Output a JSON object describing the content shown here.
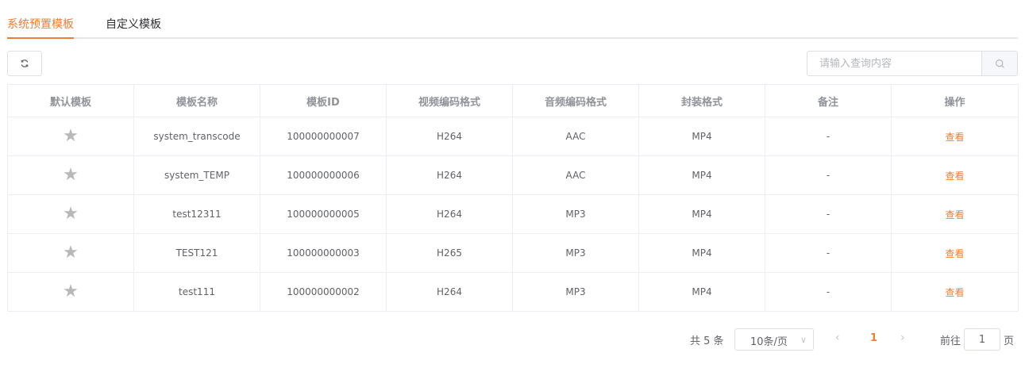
{
  "tabs": [
    {
      "label": "系统预置模板",
      "active": true
    },
    {
      "label": "自定义模板",
      "active": false
    }
  ],
  "toolbar": {
    "refresh_icon": "refresh-icon",
    "search_placeholder": "请输入查询内容",
    "search_icon": "search-icon"
  },
  "table": {
    "columns": [
      "默认模板",
      "模板名称",
      "模板ID",
      "视频编码格式",
      "音频编码格式",
      "封装格式",
      "备注",
      "操作"
    ],
    "rows": [
      {
        "default_icon": "star-icon",
        "name": "system_transcode",
        "id": "100000000007",
        "video": "H264",
        "audio": "AAC",
        "container": "MP4",
        "remark": "-",
        "action": "查看"
      },
      {
        "default_icon": "star-icon",
        "name": "system_TEMP",
        "id": "100000000006",
        "video": "H264",
        "audio": "AAC",
        "container": "MP4",
        "remark": "-",
        "action": "查看"
      },
      {
        "default_icon": "star-icon",
        "name": "test12311",
        "id": "100000000005",
        "video": "H264",
        "audio": "MP3",
        "container": "MP4",
        "remark": "-",
        "action": "查看"
      },
      {
        "default_icon": "star-icon",
        "name": "TEST121",
        "id": "100000000003",
        "video": "H265",
        "audio": "MP3",
        "container": "MP4",
        "remark": "-",
        "action": "查看"
      },
      {
        "default_icon": "star-icon",
        "name": "test111",
        "id": "100000000002",
        "video": "H264",
        "audio": "MP3",
        "container": "MP4",
        "remark": "-",
        "action": "查看"
      }
    ]
  },
  "pagination": {
    "total": "共 5 条",
    "page_size": "10条/页",
    "current_page": "1",
    "goto_label": "前往",
    "goto_value": "1",
    "goto_suffix": "页"
  },
  "colors": {
    "accent": "#ee7d37",
    "star": "#b8b8b8",
    "border": "#ebeef5"
  }
}
